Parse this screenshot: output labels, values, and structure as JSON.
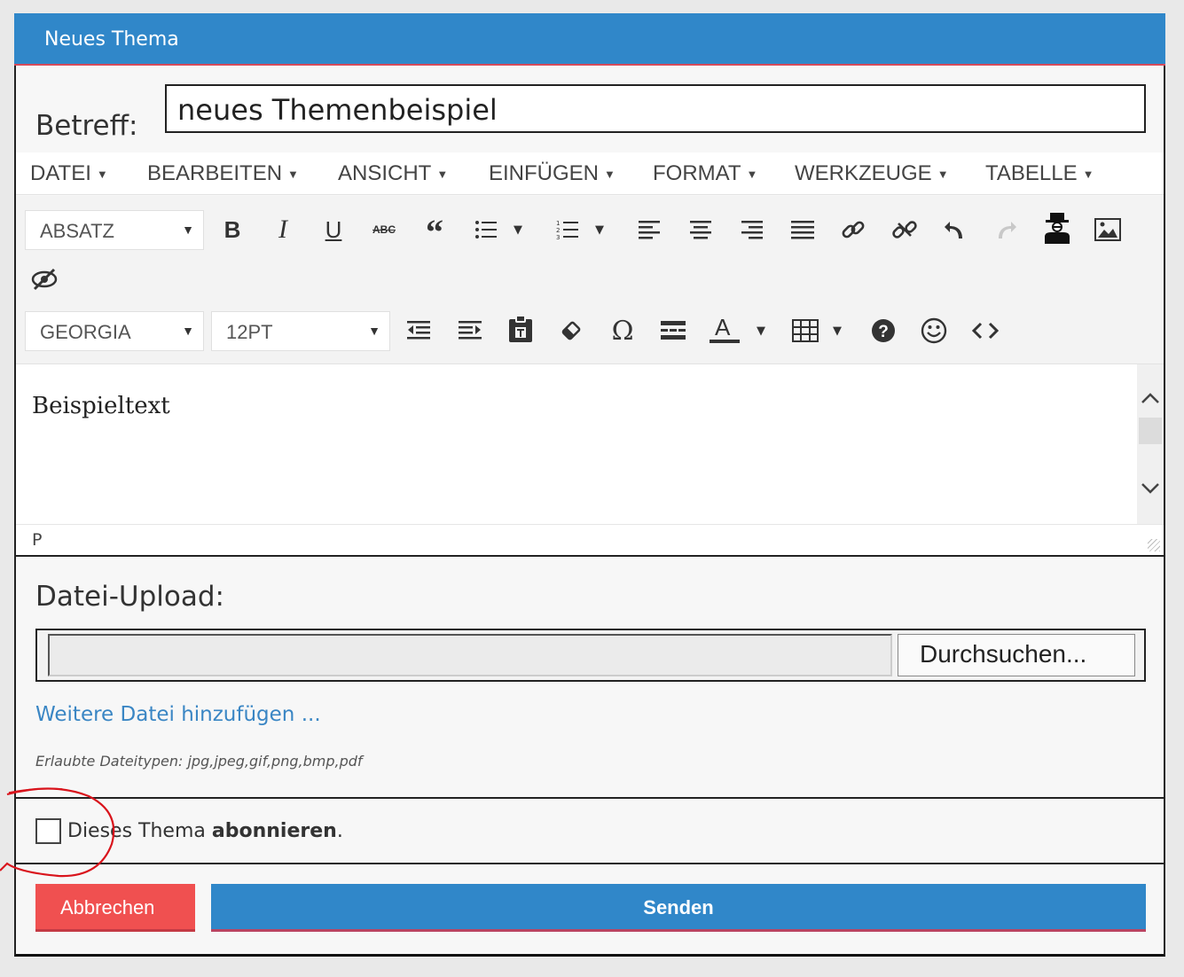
{
  "dialog": {
    "title": "Neues Thema"
  },
  "subject": {
    "label": "Betreff:",
    "value": "neues Themenbeispiel"
  },
  "menubar": {
    "items": [
      {
        "label": "DATEI"
      },
      {
        "label": "BEARBEITEN"
      },
      {
        "label": "ANSICHT"
      },
      {
        "label": "EINFÜGEN"
      },
      {
        "label": "FORMAT"
      },
      {
        "label": "WERKZEUGE"
      },
      {
        "label": "TABELLE"
      }
    ]
  },
  "toolbar": {
    "block_format": "ABSATZ",
    "font_family": "GEORGIA",
    "font_size": "12PT"
  },
  "editor": {
    "content": "Beispieltext",
    "element_path": "P"
  },
  "upload": {
    "title": "Datei-Upload:",
    "browse_label": "Durchsuchen...",
    "add_file_link": "Weitere Datei hinzufügen ...",
    "allowed_types": "Erlaubte Dateitypen: jpg,jpeg,gif,png,bmp,pdf"
  },
  "subscribe": {
    "label_start": "Dieses Thema",
    "label_bold": "abonnieren",
    "label_end": ".",
    "checked": false
  },
  "buttons": {
    "cancel": "Abbrechen",
    "send": "Senden"
  },
  "colors": {
    "header_blue": "#3087c9",
    "cancel_red": "#f05050",
    "link_blue": "#3a86c4",
    "annotation_red": "#d9141c"
  }
}
